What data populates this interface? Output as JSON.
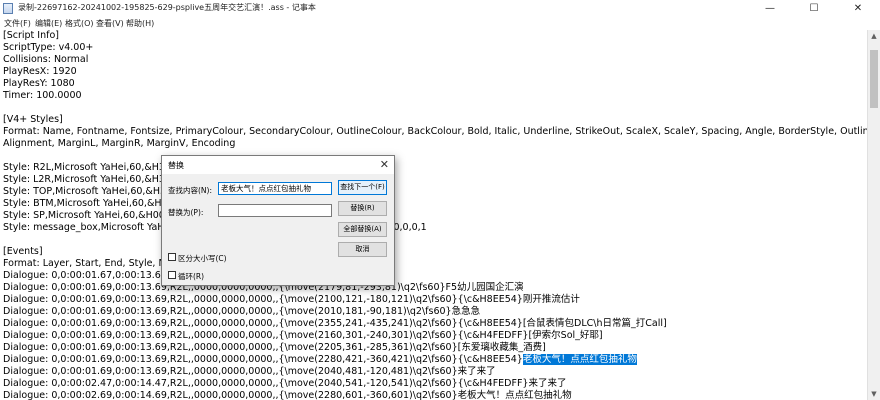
{
  "window": {
    "title": "录制-22697162-20241002-195825-629-psplive五周年交艺汇演！.ass - 记事本",
    "min_glyph": "—",
    "max_glyph": "☐",
    "close_glyph": "✕"
  },
  "menu": {
    "items": [
      "文件(F)",
      "编辑(E)",
      "格式(O)",
      "查看(V)",
      "帮助(H)"
    ]
  },
  "editor": {
    "lines": [
      "[Script Info]",
      "ScriptType: v4.00+",
      "Collisions: Normal",
      "PlayResX: 1920",
      "PlayResY: 1080",
      "Timer: 100.0000",
      "",
      "[V4+ Styles]",
      "Format: Name, Fontname, Fontsize, PrimaryColour, SecondaryColour, OutlineColour, BackColour, Bold, Italic, Underline, StrikeOut, ScaleX, ScaleY, Spacing, Angle, BorderStyle, Outline, Shadow,",
      "Alignment, MarginL, MarginR, MarginV, Encoding",
      "",
      "Style: R2L,Microsoft YaHei,60,&H37FF                                                       100.00,100.00,0.00,0.00,1,2,1,8,0,0,0,1",
      "Style: L2R,Microsoft YaHei,60,&H37FF                                                       100.00,100.00,0.00,0.00,1,2,1,8,0,0,0,1",
      "Style: TOP,Microsoft YaHei,60,&H37FF                                                    ,100.00,100.00,0.00,0.00,1,2,1,8,0,0,0,1",
      "Style: BTM,Microsoft YaHei,60,&H37FF                                                    ,100.00,100.00,0.00,0.00,1,2,1,8,0,0,0,1",
      "Style: SP,Microsoft YaHei,60,&H00FF                                                       00,100.00,0.00,0.00,1,2,1,7,0,0,0,1",
      "Style: message_box,Microsoft YaHei,3                                                   49,0,0,0,0,100.00,100.00,0.00,0.00,1,2,1,7,0,0,0,1",
      "",
      "[Events]",
      "Format: Layer, Start, End, Style, Name",
      "Dialogue: 0,0:00:01.67,0:00:13.67,R2L,                                                                              了",
      "Dialogue: 0,0:00:01.69,0:00:13.69,R2L,,0000,0000,0000,,{\\move(2179,81,-293,81)\\q2\\fs60}F5幼儿园国企汇演",
      "Dialogue: 0,0:00:01.69,0:00:13.69,R2L,,0000,0000,0000,,{\\move(2100,121,-180,121)\\q2\\fs60}{\\c&H8EE54}刚开推流估计",
      "Dialogue: 0,0:00:01.69,0:00:13.69,R2L,,0000,0000,0000,,{\\move(2010,181,-90,181)\\q2\\fs60}急急急",
      "Dialogue: 0,0:00:01.69,0:00:13.69,R2L,,0000,0000,0000,,{\\move(2355,241,-435,241)\\q2\\fs60}{\\c&H8EE54}[合鼠表情包DLC\\h日常篇_打Call]",
      "Dialogue: 0,0:00:01.69,0:00:13.69,R2L,,0000,0000,0000,,{\\move(2160,301,-240,301)\\q2\\fs60}{\\c&H4FEDFF}[伊索尔Sol_好耶]",
      "Dialogue: 0,0:00:01.69,0:00:13.69,R2L,,0000,0000,0000,,{\\move(2205,361,-285,361)\\q2\\fs60}[东爱璃收藏集_酒费]",
      "Dialogue: 0,0:00:01.69,0:00:13.69,R2L,,0000,0000,0000,,{\\move(2280,421,-360,421)\\q2\\fs60}{\\c&H8EE54}",
      "Dialogue: 0,0:00:01.69,0:00:13.69,R2L,,0000,0000,0000,,{\\move(2040,481,-120,481)\\q2\\fs60}来了来了",
      "Dialogue: 0,0:00:02.47,0:00:14.47,R2L,,0000,0000,0000,,{\\move(2040,541,-120,541)\\q2\\fs60}{\\c&H4FEDFF}来了来了",
      "Dialogue: 0,0:00:02.69,0:00:14.69,R2L,,0000,0000,0000,,{\\move(2280,601,-360,601)\\q2\\fs60}老板大气！点点红包抽礼物"
    ],
    "highlight_text": "老板大气！点点红包抽礼物"
  },
  "dialog": {
    "title": "替换",
    "find_label": "查找内容(N):",
    "find_value": "老板大气！点点红包抽礼物",
    "replace_label": "替换为(P):",
    "replace_value": "",
    "find_next_button": "查找下一个(F)",
    "replace_button": "替换(R)",
    "replace_all_button": "全部替换(A)",
    "cancel_button": "取消",
    "match_case_label": "区分大小写(C)",
    "wrap_label": "循环(R)",
    "close_glyph": "✕"
  }
}
